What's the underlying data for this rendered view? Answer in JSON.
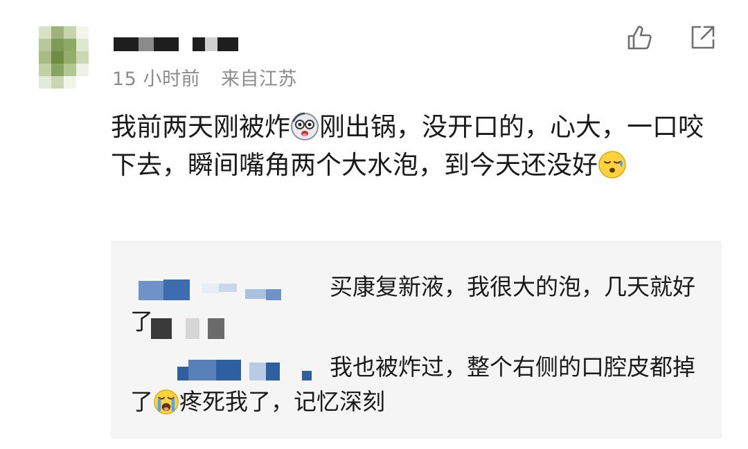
{
  "post": {
    "time": "15 小时前",
    "location": "来自江苏",
    "content": {
      "part1": "我前两天刚被炸",
      "part2": "刚出锅，没开口的，心大，一口咬下去，瞬间嘴角两个大水泡，到今天还没好",
      "emoji1": "dizzy-face-emoji",
      "emoji2": "sweat-face-emoji"
    },
    "actions": {
      "like_icon": "thumbs-up-icon",
      "share_icon": "share-icon"
    }
  },
  "replies": [
    {
      "text": "买康复新液，我很大的泡，几天就好了"
    },
    {
      "text_a": "我也被炸过，整个右侧的口腔皮都掉了",
      "emoji": "crying-face-emoji",
      "text_b": "疼死我了，记忆深刻"
    }
  ],
  "colors": {
    "meta_gray": "#8c8c8c",
    "reply_bg": "#f5f5f5",
    "icon_gray": "#6f6f6f"
  }
}
